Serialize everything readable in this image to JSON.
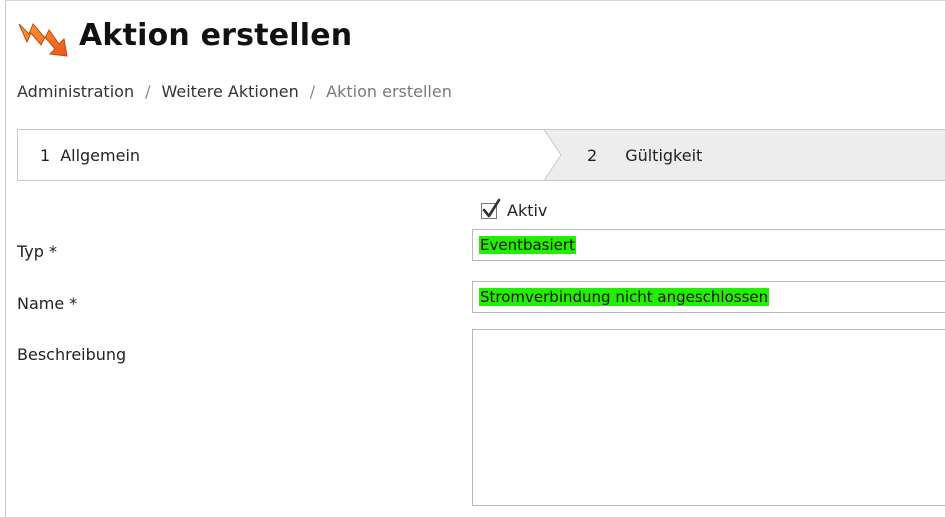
{
  "page": {
    "title": "Aktion erstellen",
    "logo_icon": "orange-arrow-logo-icon"
  },
  "breadcrumb": {
    "items": [
      "Administration",
      "Weitere Aktionen",
      "Aktion erstellen"
    ],
    "separator": "/"
  },
  "wizard": {
    "steps": [
      {
        "number": "1",
        "label": "Allgemein"
      },
      {
        "number": "2",
        "label": "Gültigkeit"
      }
    ]
  },
  "form": {
    "active": {
      "label": "Aktiv",
      "checked": true
    },
    "typ": {
      "label": "Typ *",
      "value": "Eventbasiert"
    },
    "name": {
      "label": "Name *",
      "value": "Stromverbindung nicht angeschlossen"
    },
    "description": {
      "label": "Beschreibung",
      "value": ""
    }
  },
  "colors": {
    "highlight": "#22ee00",
    "logo_orange": "#f07a1a",
    "step_active_bg": "#ffffff",
    "step_inactive_bg": "#ededed"
  }
}
